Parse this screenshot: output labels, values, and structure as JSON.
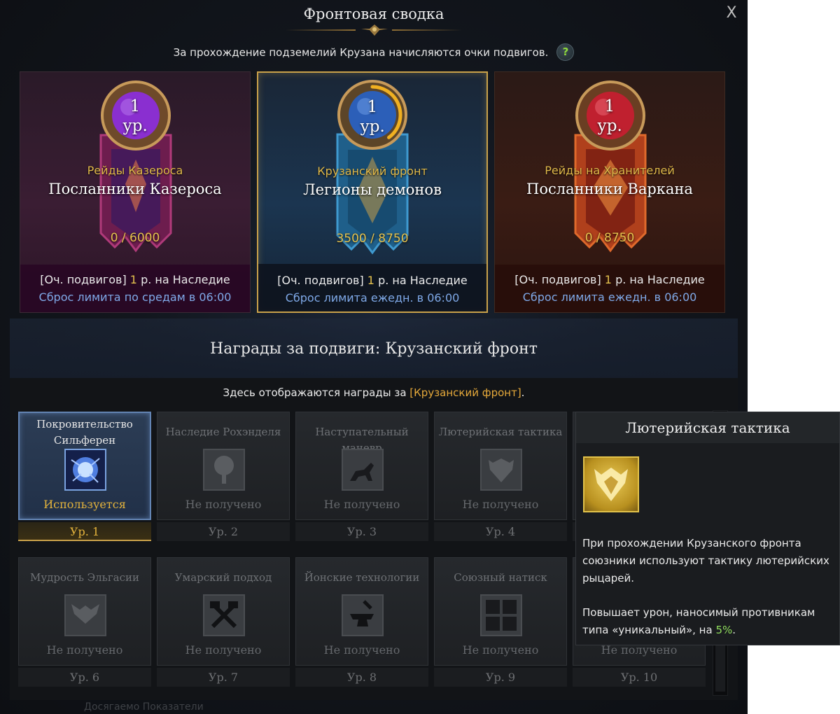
{
  "window": {
    "title": "Фронтовая сводка",
    "close_label": "X",
    "intro": "За прохождение подземелий Крузана начисляются очки подвигов.",
    "help_label": "?"
  },
  "cards": [
    {
      "level_num": "1",
      "level_unit": "ур.",
      "category": "Рейды Казероса",
      "name": "Посланники Казероса",
      "progress": "0 / 6000",
      "legacy_prefix": "[Оч. подвигов]",
      "legacy_value": "1",
      "legacy_suffix": "р. на Наследие",
      "reset": "Сброс лимита по средам в 06:00",
      "orb_color": "#8a2fd0",
      "selected": false
    },
    {
      "level_num": "1",
      "level_unit": "ур.",
      "category": "Крузанский фронт",
      "name": "Легионы демонов",
      "progress": "3500 / 8750",
      "progress_fraction": 0.4,
      "legacy_prefix": "[Оч. подвигов]",
      "legacy_value": "1",
      "legacy_suffix": "р. на Наследие",
      "reset": "Сброс лимита ежедн. в 06:00",
      "orb_color": "#2c5fb8",
      "selected": true
    },
    {
      "level_num": "1",
      "level_unit": "ур.",
      "category": "Рейды на Хранителей",
      "name": "Посланники Варкана",
      "progress": "0 / 8750",
      "legacy_prefix": "[Оч. подвигов]",
      "legacy_value": "1",
      "legacy_suffix": "р. на Наследие",
      "reset": "Сброс лимита ежедн. в 06:00",
      "orb_color": "#c0202f",
      "selected": false
    }
  ],
  "rewards": {
    "section_title": "Награды за подвиги: Крузанский фронт",
    "desc_prefix": "Здесь отображаются награды за ",
    "desc_highlight": "[Крузанский фронт]",
    "desc_suffix": ".",
    "items": [
      {
        "name": "Покровительство Сильферен",
        "status": "Используется",
        "level": "Ур. 1",
        "icon": "spirit-orb-icon",
        "active": true
      },
      {
        "name": "Наследие Рохэнделя",
        "status": "Не получено",
        "level": "Ур. 2",
        "icon": "tree-icon",
        "active": false
      },
      {
        "name": "Наступательный маневр",
        "status": "Не получено",
        "level": "Ур. 3",
        "icon": "cavalry-icon",
        "active": false
      },
      {
        "name": "Лютерийская тактика",
        "status": "Не получено",
        "level": "Ур. 4",
        "icon": "griffin-crest-icon",
        "active": false
      },
      {
        "name": "",
        "status": "",
        "level": "",
        "icon": "",
        "active": false
      },
      {
        "name": "Мудрость Эльгасии",
        "status": "Не получено",
        "level": "Ур. 6",
        "icon": "wings-icon",
        "active": false
      },
      {
        "name": "Умарский подход",
        "status": "Не получено",
        "level": "Ур. 7",
        "icon": "crossed-hammers-icon",
        "active": false
      },
      {
        "name": "Йонские технологии",
        "status": "Не получено",
        "level": "Ур. 8",
        "icon": "anvil-icon",
        "active": false
      },
      {
        "name": "Союзный натиск",
        "status": "Не получено",
        "level": "Ур. 9",
        "icon": "alliance-emblems-icon",
        "active": false
      },
      {
        "name": "",
        "status": "Не получено",
        "level": "Ур. 10",
        "icon": "",
        "active": false
      }
    ]
  },
  "footer": {
    "partial_text": "Досягаемо   Показатели"
  },
  "tooltip": {
    "title": "Лютерийская тактика",
    "icon": "griffin-crest-icon",
    "description": "При прохождении Крузанского фронта союзники используют тактику лютерийских рыцарей.",
    "effect_prefix": "Повышает урон, наносимый противникам типа «уникальный», на ",
    "effect_value": "5%",
    "effect_suffix": "."
  },
  "colors": {
    "accent_gold": "#e4c14d",
    "reset_blue": "#7fa9e8",
    "effect_green": "#8fdc5c",
    "highlight_orange": "#e4a83a"
  }
}
